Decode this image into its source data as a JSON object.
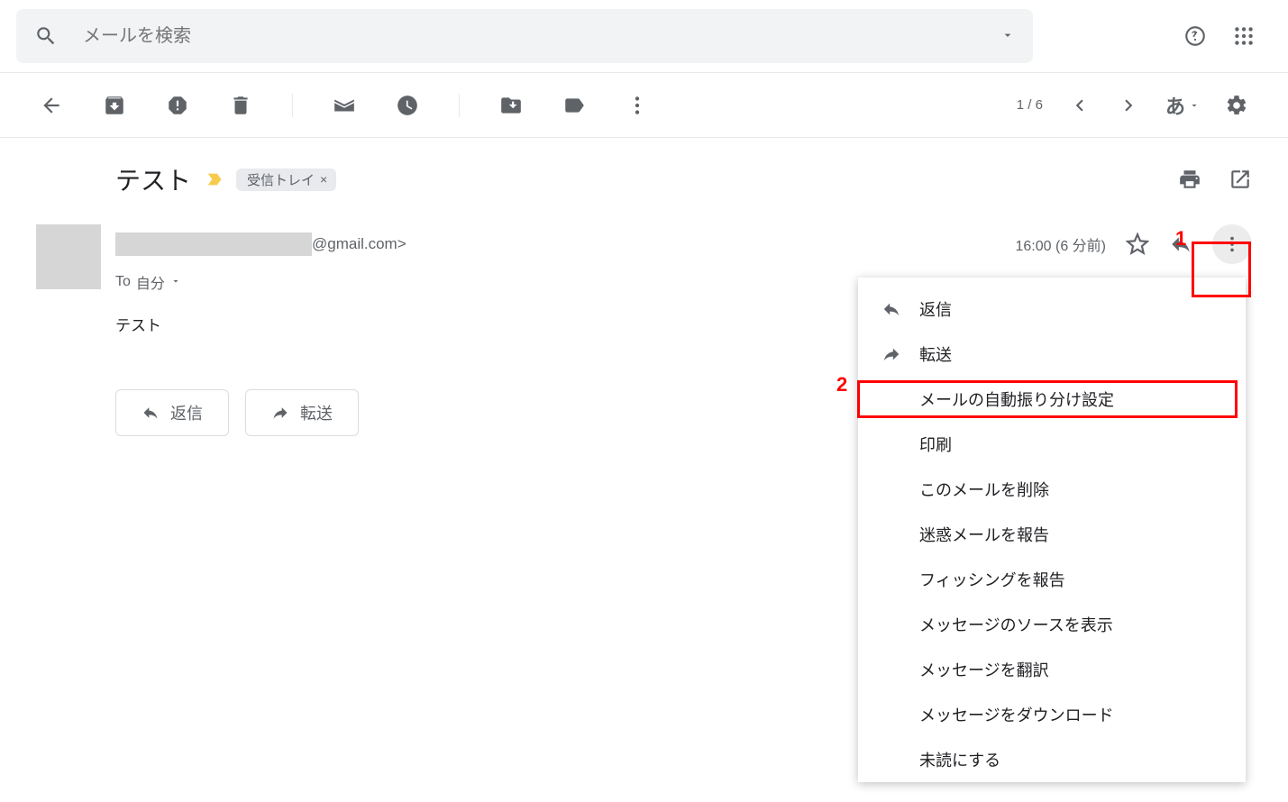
{
  "search": {
    "placeholder": "メールを検索"
  },
  "toolbar": {
    "page_count": "1 / 6",
    "input_indicator": "あ"
  },
  "subject": "テスト",
  "inbox_label": "受信トレイ",
  "sender": {
    "email_suffix": "@gmail.com>",
    "to_prefix": "To",
    "to_value": "自分",
    "timestamp": "16:00 (6 分前)"
  },
  "body": "テスト",
  "actions": {
    "reply": "返信",
    "forward": "転送"
  },
  "dropdown": {
    "reply": "返信",
    "forward": "転送",
    "filter": "メールの自動振り分け設定",
    "print": "印刷",
    "delete": "このメールを削除",
    "spam": "迷惑メールを報告",
    "phishing": "フィッシングを報告",
    "show_original": "メッセージのソースを表示",
    "translate": "メッセージを翻訳",
    "download": "メッセージをダウンロード",
    "mark_unread": "未読にする"
  },
  "annotations": {
    "one": "1",
    "two": "2"
  }
}
